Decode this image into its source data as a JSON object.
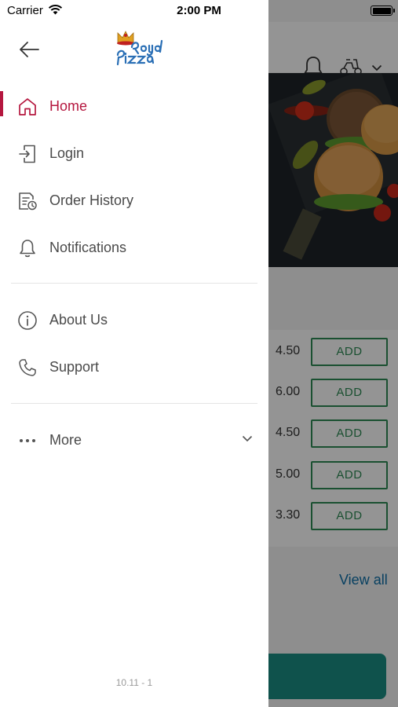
{
  "status_bar": {
    "carrier": "Carrier",
    "time": "2:00 PM"
  },
  "drawer": {
    "logo_text": "Royal Pizza",
    "menu_items": [
      {
        "label": "Home",
        "icon": "home-icon",
        "active": true
      },
      {
        "label": "Login",
        "icon": "login-icon",
        "active": false
      },
      {
        "label": "Order History",
        "icon": "order-history-icon",
        "active": false
      },
      {
        "label": "Notifications",
        "icon": "bell-icon",
        "active": false
      }
    ],
    "secondary_items": [
      {
        "label": "About Us",
        "icon": "info-icon"
      },
      {
        "label": "Support",
        "icon": "phone-icon"
      }
    ],
    "more_label": "More",
    "version": "10.11 - 1"
  },
  "background": {
    "prices": [
      "4.50",
      "6.00",
      "4.50",
      "5.00",
      "3.30"
    ],
    "add_label": "ADD",
    "view_all": "View all"
  },
  "colors": {
    "accent": "#b5173f",
    "add_green": "#2e8a55",
    "link_blue": "#0d6ea8",
    "teal": "#1b8d83"
  }
}
